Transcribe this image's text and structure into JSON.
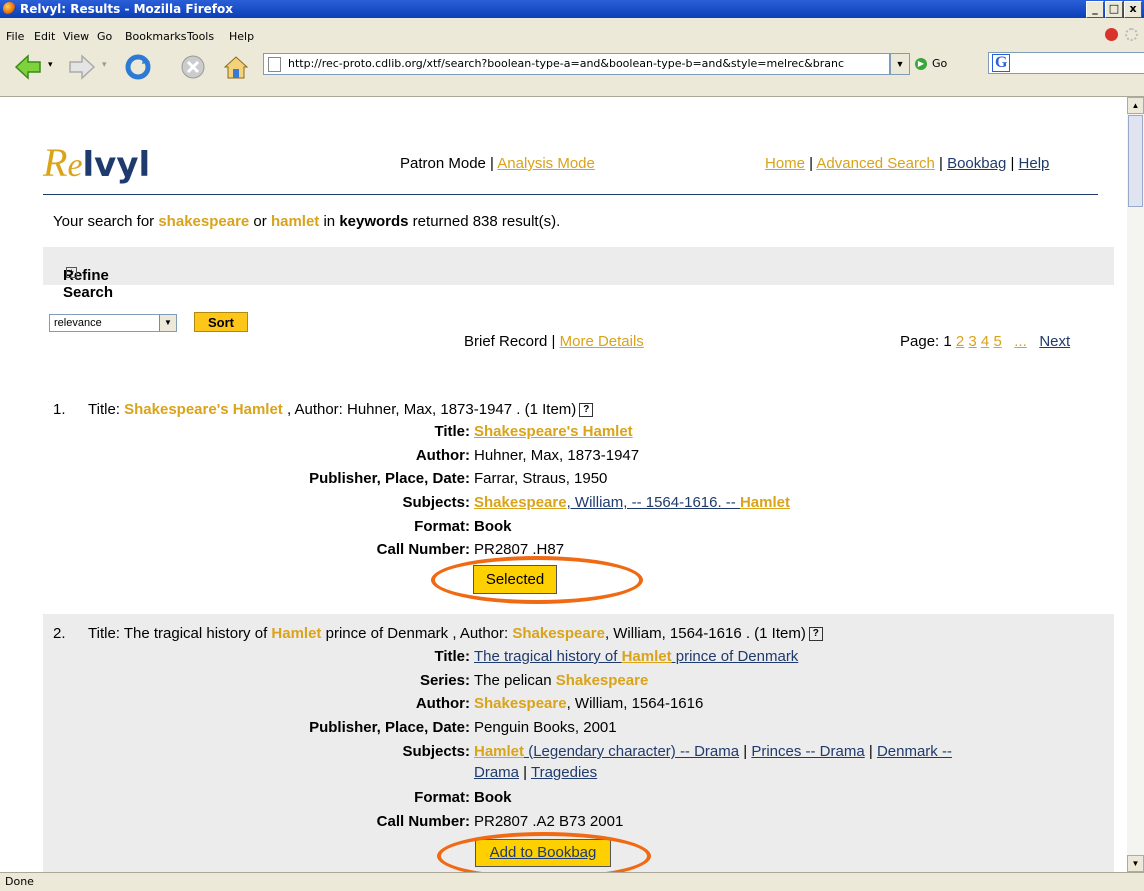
{
  "window": {
    "title": "Relvyl: Results - Mozilla Firefox",
    "controls": [
      "_",
      "□",
      "x"
    ]
  },
  "menu": {
    "items": [
      "File",
      "Edit",
      "View",
      "Go",
      "Bookmarks",
      "Tools",
      "Help"
    ]
  },
  "toolbar": {
    "url": "http://rec-proto.cdlib.org/xtf/search?boolean-type-a=and&boolean-type-b=and&style=melrec&branc",
    "go_label": "Go",
    "search_engine": "G"
  },
  "status": {
    "text": "Done"
  },
  "page": {
    "logo": {
      "first": "R",
      "second": "e",
      "rest": "lvyl"
    },
    "modes": {
      "patron": "Patron Mode",
      "sep": " | ",
      "analysis": "Analysis Mode"
    },
    "toplinks": {
      "home": "Home",
      "advanced": "Advanced Search",
      "bookbag": "Bookbag",
      "help": "Help",
      "sep": " | "
    },
    "summary": {
      "prefix": "Your search for ",
      "term1": "shakespeare",
      "or": " or ",
      "term2": "hamlet",
      "in": " in ",
      "field": "keywords",
      "suffix": " returned 838 result(s)."
    },
    "refine": {
      "label": "Refine Search",
      "plus": "+"
    },
    "sort": {
      "selected": "relevance",
      "button": "Sort"
    },
    "views": {
      "brief": "Brief Record",
      "sep": " | ",
      "more": "More Details"
    },
    "pager": {
      "label": "Page:",
      "current": "1",
      "pages": [
        "2",
        "3",
        "4",
        "5"
      ],
      "ellipsis": "...",
      "next": "Next"
    },
    "records": [
      {
        "num": "1.",
        "title_prefix": "Title: ",
        "title": "Shakespeare's Hamlet",
        "author_prefix": " , Author: Huhner, Max, 1873-1947 . (1 Item)",
        "labels": {
          "title": "Title:",
          "author": "Author:",
          "publisher": "Publisher, Place, Date:",
          "subjects": "Subjects:",
          "format": "Format:",
          "call": "Call Number:"
        },
        "values": {
          "title": "Shakespeare's Hamlet",
          "author": "Huhner, Max, 1873-1947",
          "publisher": "Farrar, Straus, 1950",
          "subjects_kw1": "Shakespeare",
          "subjects_mid": ", William, -- 1564-1616. -- ",
          "subjects_kw2": "Hamlet",
          "format": "Book",
          "call": "PR2807 .H87"
        },
        "button": "Selected"
      },
      {
        "num": "2.",
        "line_a": "Title: The tragical history of ",
        "line_kw1": "Hamlet",
        "line_b": " prince of Denmark , Author: ",
        "line_kw2": "Shakespeare",
        "line_c": ", William, 1564-1616 . (1 Item)",
        "labels": {
          "title": "Title:",
          "series": "Series:",
          "author": "Author:",
          "publisher": "Publisher, Place, Date:",
          "subjects": "Subjects:",
          "format": "Format:",
          "call": "Call Number:"
        },
        "values": {
          "title_a": "The tragical history of ",
          "title_kw": "Hamlet",
          "title_b": " prince of Denmark",
          "series_a": "The pelican ",
          "series_kw": "Shakespeare",
          "author_kw": "Shakespeare",
          "author_b": ", William, 1564-1616",
          "publisher": "Penguin Books, 2001",
          "subj_kw": "Hamlet",
          "subj_a": " (Legendary character) -- Drama",
          "subj_sep": " | ",
          "subj_b": "Princes -- Drama",
          "subj_c": "Denmark --",
          "subj_d": "Drama",
          "subj_e": "Tragedies",
          "format": "Book",
          "call": "PR2807 .A2 B73 2001"
        },
        "button": "Add to Bookbag"
      }
    ]
  }
}
